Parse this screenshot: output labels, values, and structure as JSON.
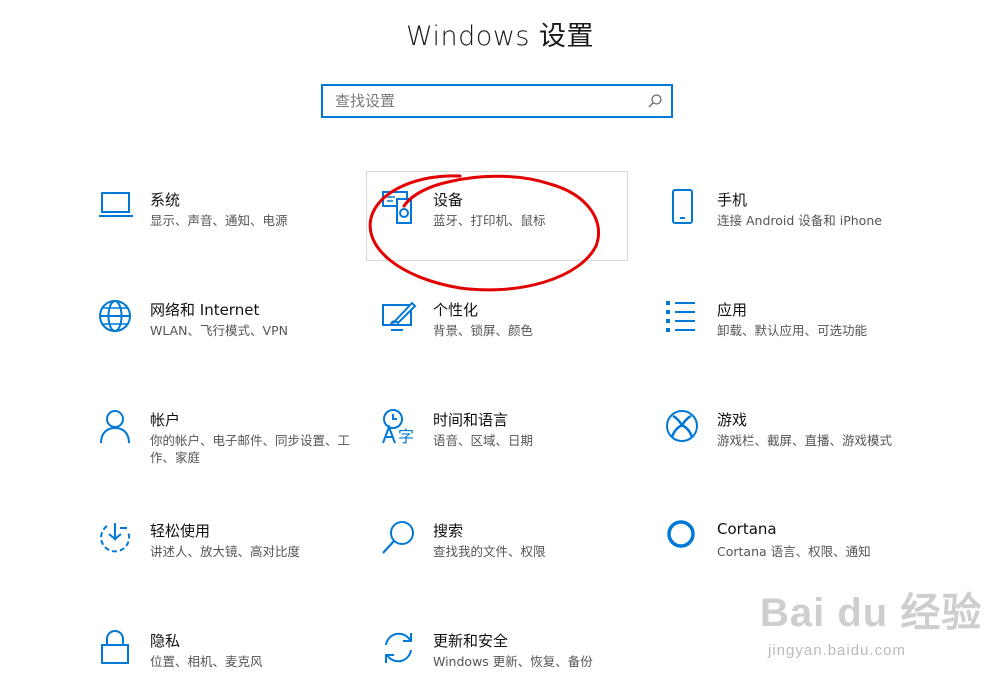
{
  "header": {
    "title": "Windows 设置"
  },
  "search": {
    "placeholder": "查找设置"
  },
  "tiles": [
    {
      "name": "系统",
      "desc": "显示、声音、通知、电源",
      "icon": "laptop-icon"
    },
    {
      "name": "设备",
      "desc": "蓝牙、打印机、鼠标",
      "icon": "devices-icon"
    },
    {
      "name": "手机",
      "desc": "连接 Android 设备和 iPhone",
      "icon": "phone-icon"
    },
    {
      "name": "网络和 Internet",
      "desc": "WLAN、飞行模式、VPN",
      "icon": "globe-icon"
    },
    {
      "name": "个性化",
      "desc": "背景、锁屏、颜色",
      "icon": "personalization-icon"
    },
    {
      "name": "应用",
      "desc": "卸载、默认应用、可选功能",
      "icon": "apps-list-icon"
    },
    {
      "name": "帐户",
      "desc": "你的帐户、电子邮件、同步设置、工作、家庭",
      "icon": "person-icon"
    },
    {
      "name": "时间和语言",
      "desc": "语音、区域、日期",
      "icon": "time-language-icon"
    },
    {
      "name": "游戏",
      "desc": "游戏栏、截屏、直播、游戏模式",
      "icon": "xbox-icon"
    },
    {
      "name": "轻松使用",
      "desc": "讲述人、放大镜、高对比度",
      "icon": "ease-of-access-icon"
    },
    {
      "name": "搜索",
      "desc": "查找我的文件、权限",
      "icon": "search-icon"
    },
    {
      "name": "Cortana",
      "desc": "Cortana 语言、权限、通知",
      "icon": "cortana-icon"
    },
    {
      "name": "隐私",
      "desc": "位置、相机、麦克风",
      "icon": "lock-icon"
    },
    {
      "name": "更新和安全",
      "desc": "Windows 更新、恢复、备份",
      "icon": "sync-icon"
    }
  ],
  "watermark": {
    "logo": "Bai du 经验",
    "url": "jingyan.baidu.com"
  },
  "colors": {
    "accent": "#0078d7",
    "annotation": "#e30000"
  }
}
